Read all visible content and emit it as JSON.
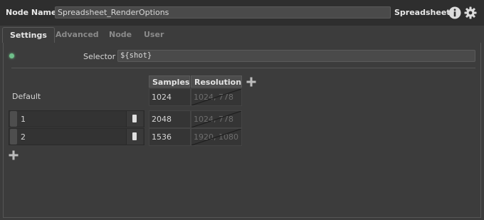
{
  "header": {
    "node_name_label": "Node Name",
    "node_name_value": "Spreadsheet_RenderOptions",
    "node_type": "Spreadsheet",
    "info_icon": "info-icon",
    "settings_icon": "gear-icon"
  },
  "tabs": [
    {
      "label": "Settings",
      "active": true
    },
    {
      "label": "Advanced",
      "active": false
    },
    {
      "label": "Node",
      "active": false
    },
    {
      "label": "User",
      "active": false
    }
  ],
  "selector": {
    "label": "Selector",
    "value": "${shot}"
  },
  "table": {
    "columns": [
      "Samples",
      "Resolution"
    ],
    "default_label": "Default",
    "default_values": [
      "1024",
      "1024, 778"
    ],
    "rows": [
      {
        "label": "1",
        "samples": "2048",
        "resolution": "1024, 778",
        "resolution_enabled": false
      },
      {
        "label": "2",
        "samples": "1536",
        "resolution": "1920, 1080",
        "resolution_enabled": false
      }
    ]
  },
  "colors": {
    "background": "#3c3c3c",
    "header": "#2e2e2e",
    "field": "#4a4a4a",
    "status_dot": "#6fbf8a"
  }
}
